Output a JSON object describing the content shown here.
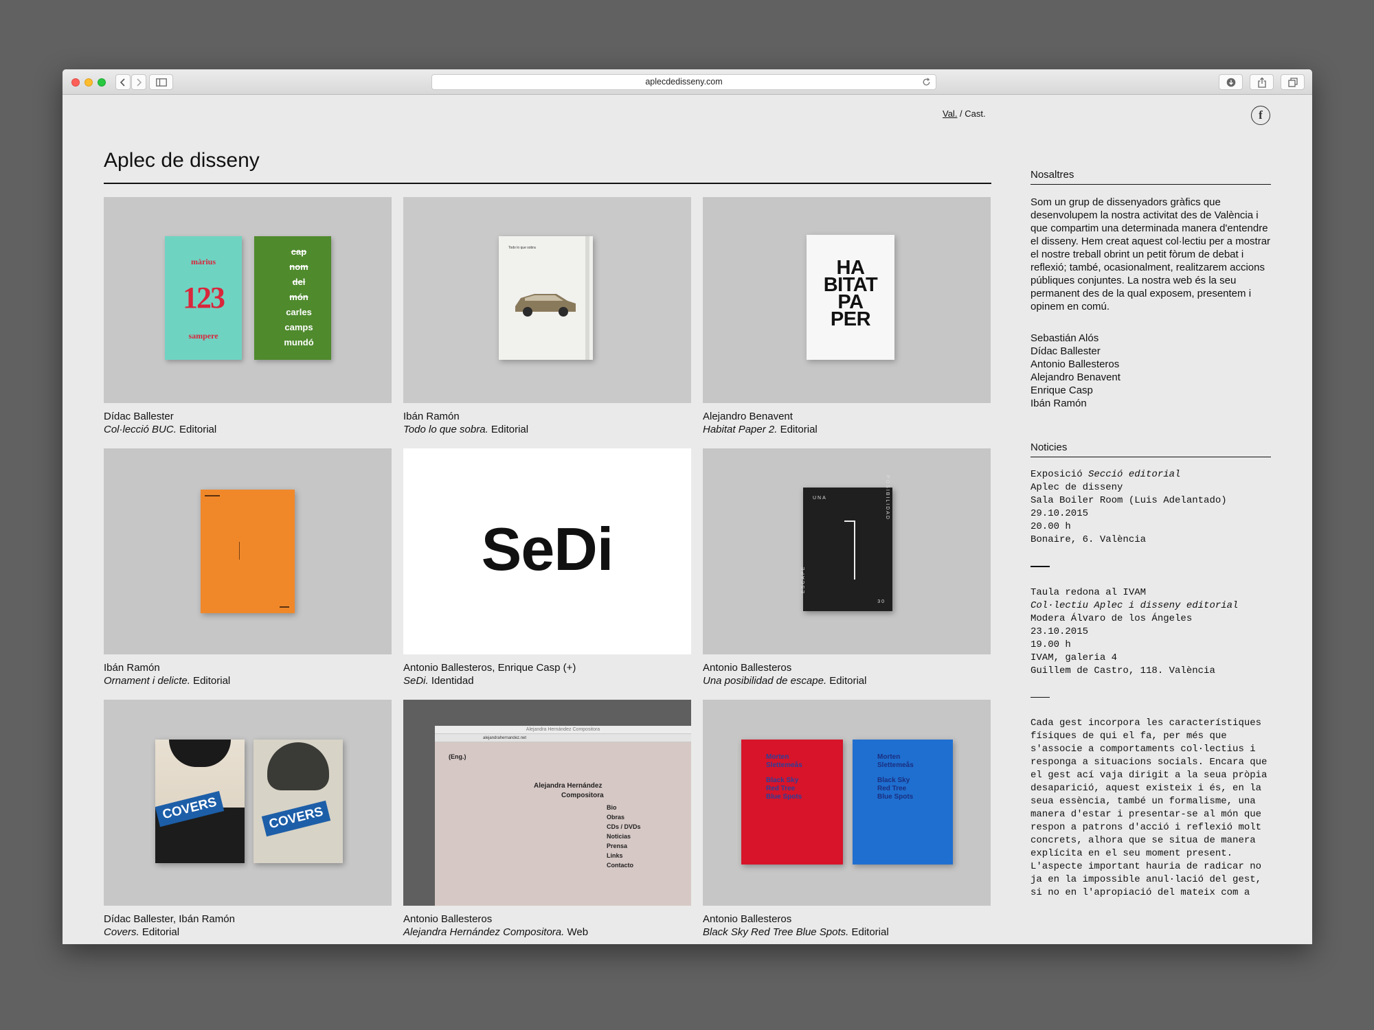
{
  "browser": {
    "url": "aplecdedisseny.com"
  },
  "header": {
    "lang_val": "Val.",
    "lang_sep": " / ",
    "lang_cast": "Cast.",
    "fb_label": "f"
  },
  "site_title": "Aplec de disseny",
  "projects": [
    {
      "author": "Dídac Ballester",
      "title": "Col·lecció BUC.",
      "type": " Editorial"
    },
    {
      "author": "Ibán Ramón",
      "title": "Todo lo que sobra.",
      "type": " Editorial"
    },
    {
      "author": "Alejandro Benavent",
      "title": "Habitat Paper 2.",
      "type": " Editorial"
    },
    {
      "author": "Ibán Ramón",
      "title": "Ornament i delicte.",
      "type": " Editorial"
    },
    {
      "author": "Antonio Ballesteros, Enrique Casp (+)",
      "title": "SeDi.",
      "type": " Identidad"
    },
    {
      "author": "Antonio Ballesteros",
      "title": "Una posibilidad de escape.",
      "type": " Editorial"
    },
    {
      "author": "Dídac Ballester, Ibán Ramón",
      "title": "Covers.",
      "type": " Editorial"
    },
    {
      "author": "Antonio Ballesteros",
      "title": "Alejandra Hernández Compositora.",
      "type": " Web"
    },
    {
      "author": "Antonio Ballesteros",
      "title": "Black Sky Red Tree Blue Spots.",
      "type": " Editorial"
    }
  ],
  "thumb_text": {
    "marius": "màrius",
    "n123": "123",
    "sampere": "sampere",
    "cap": "cap",
    "nom": "nom",
    "del": "del",
    "mon": "món",
    "carles": "carles",
    "camps": "camps",
    "mundo": "mundó",
    "todo": "Todo lo que sobra",
    "hab1": "HA",
    "hab2": "BITAT",
    "hab3": "PA",
    "hab4": "PER",
    "sedi": "SeDi",
    "una": "UNA",
    "posibilidad": "POSIBILIDAD",
    "escape": "ESCAPE",
    "num30": "30",
    "covers": "COVERS",
    "web_title": "Alejandra Hernández Compositora",
    "web_url": "alejandrahernandez.net",
    "web_eng": "(Eng.)",
    "web_name1": "Alejandra Hernández",
    "web_name2": "Compositora",
    "web_menu": [
      "Bio",
      "Obras",
      "CDs / DVDs",
      "Noticias",
      "Prensa",
      "Links",
      "Contacto"
    ],
    "morten1": "Morten",
    "morten2": "Slettemeås",
    "bk1": "Black Sky",
    "bk2": "Red Tree",
    "bk3": "Blue Spots"
  },
  "sidebar": {
    "about_heading": "Nosaltres",
    "about_text": "Som un grup de dissenyadors gràfics que desenvolupem la nostra activitat des de València i que compartim una determinada manera d'entendre el disseny. Hem creat aquest col·lectiu per a mostrar el nostre treball obrint un petit fòrum de debat i reflexió; també, ocasionalment, realitzarem accions públiques conjuntes. La nostra web és la seu permanent des de la qual exposem, presentem i opinem en comú.",
    "members": [
      "Sebastián Alós",
      "Dídac Ballester",
      "Antonio Ballesteros",
      "Alejandro Benavent",
      "Enrique Casp",
      "Ibán Ramón"
    ],
    "news_heading": "Noticies",
    "news1": {
      "line1_pre": "Exposició ",
      "line1_em": "Secció editorial",
      "lines": [
        "Aplec de disseny",
        "Sala Boiler Room (Luis Adelantado)",
        "29.10.2015",
        "20.00 h",
        "Bonaire, 6. València"
      ]
    },
    "news2": {
      "line1": "Taula redona al IVAM",
      "line2_em": "Col·lectiu Aplec i disseny editorial",
      "lines": [
        "Modera Álvaro de los Ángeles",
        "23.10.2015",
        "19.00 h",
        "IVAM, galeria 4",
        "Guillem de Castro, 118. València"
      ]
    },
    "essay": "Cada gest incorpora les característiques físiques de qui el fa, per més que s'associe a comportaments col·lectius i responga a situacions socials. Encara que el gest ací vaja dirigit a la seua pròpia desaparició, aquest existeix i és, en la seua essència, també un formalisme, una manera d'estar i presentar-se al món que respon a patrons d'acció i reflexió molt concrets, alhora que se situa de manera explícita en el seu moment present. L'aspecte important hauria de radicar no ja en la impossible anul·lació del gest, si no en l'apropiació del mateix com a"
  }
}
